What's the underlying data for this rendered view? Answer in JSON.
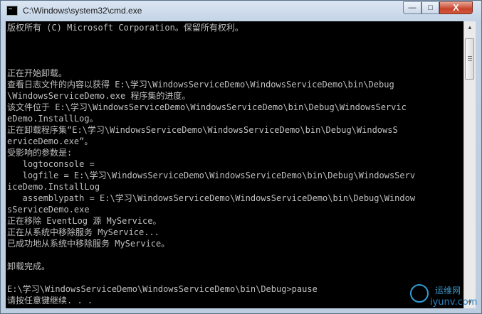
{
  "window": {
    "title": "C:\\Windows\\system32\\cmd.exe",
    "icon": "console-icon",
    "controls": {
      "minimize": "—",
      "maximize": "□",
      "close": "X"
    }
  },
  "console": {
    "text_color": "#c0c0c0",
    "background": "#000000",
    "lines": [
      "版权所有 (C) Microsoft Corporation。保留所有权利。",
      "",
      "",
      "",
      "正在开始卸载。",
      "查看日志文件的内容以获得 E:\\学习\\WindowsServiceDemo\\WindowsServiceDemo\\bin\\Debug",
      "\\WindowsServiceDemo.exe 程序集的进度。",
      "该文件位于 E:\\学习\\WindowsServiceDemo\\WindowsServiceDemo\\bin\\Debug\\WindowsServic",
      "eDemo.InstallLog。",
      "正在卸载程序集“E:\\学习\\WindowsServiceDemo\\WindowsServiceDemo\\bin\\Debug\\WindowsS",
      "erviceDemo.exe”。",
      "受影响的参数是:",
      "   logtoconsole =",
      "   logfile = E:\\学习\\WindowsServiceDemo\\WindowsServiceDemo\\bin\\Debug\\WindowsServ",
      "iceDemo.InstallLog",
      "   assemblypath = E:\\学习\\WindowsServiceDemo\\WindowsServiceDemo\\bin\\Debug\\Window",
      "sServiceDemo.exe",
      "正在移除 EventLog 源 MyService。",
      "正在从系统中移除服务 MyService...",
      "已成功地从系统中移除服务 MyService。",
      "",
      "卸载完成。",
      "",
      "E:\\学习\\WindowsServiceDemo\\WindowsServiceDemo\\bin\\Debug>pause",
      "请按任意键继续. . ."
    ]
  },
  "scrollbar": {
    "up_arrow": "▲",
    "down_arrow": "▼"
  },
  "watermark": {
    "top_text": "运维网",
    "bottom_text": "iyunv.com"
  }
}
